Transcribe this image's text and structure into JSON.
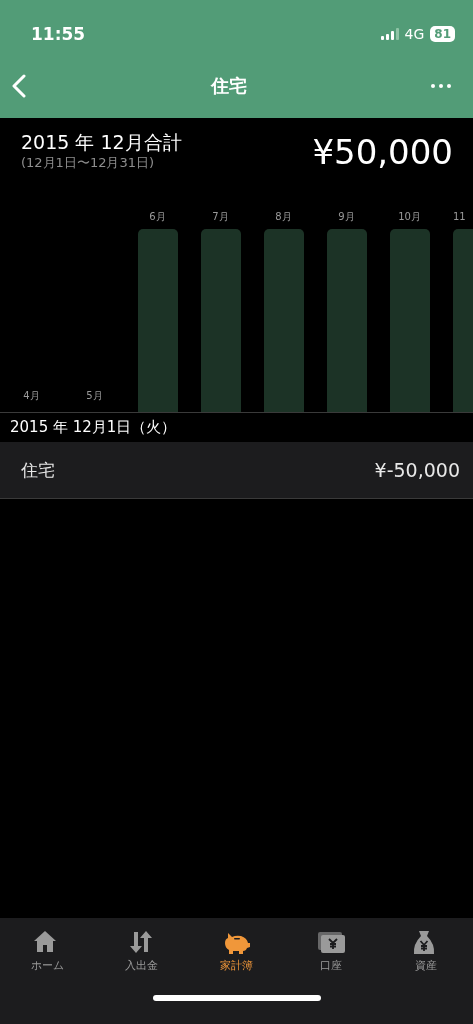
{
  "status_bar": {
    "time": "11:55",
    "network": "4G",
    "battery": "81"
  },
  "nav": {
    "title": "住宅"
  },
  "summary": {
    "title": "2015 年 12月合計",
    "range": "(12月1日〜12月31日)",
    "total": "¥50,000"
  },
  "months": [
    {
      "label": "4月",
      "kind": "empty"
    },
    {
      "label": "5月",
      "kind": "empty"
    },
    {
      "label": "6月",
      "kind": "bar"
    },
    {
      "label": "7月",
      "kind": "bar"
    },
    {
      "label": "8月",
      "kind": "bar"
    },
    {
      "label": "9月",
      "kind": "bar"
    },
    {
      "label": "10月",
      "kind": "bar"
    },
    {
      "label": "11",
      "kind": "partial"
    }
  ],
  "day": {
    "date": "2015 年 12月1日（火）",
    "entries": [
      {
        "category": "住宅",
        "amount": "¥-50,000"
      }
    ]
  },
  "tab_bar": [
    {
      "label": "ホーム",
      "kind": "home",
      "selected": false
    },
    {
      "label": "入出金",
      "kind": "transfer",
      "selected": false
    },
    {
      "label": "家計簿",
      "kind": "piggy",
      "selected": true
    },
    {
      "label": "口座",
      "kind": "wallet",
      "selected": false
    },
    {
      "label": "資産",
      "kind": "bag",
      "selected": false
    }
  ]
}
